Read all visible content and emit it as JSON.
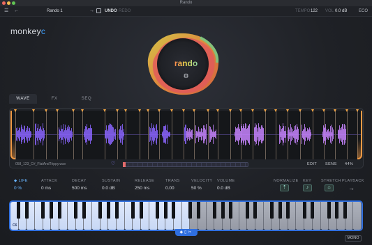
{
  "window": {
    "title": "Rando"
  },
  "toolbar": {
    "menu_icon": "hamburger-menu-icon",
    "back_icon": "arrow-left-icon",
    "preset_name": "Rando 1",
    "forward_icon": "arrow-right-icon",
    "save_icon": "save-icon",
    "undo_label": "UNDO",
    "redo_label": "REDO",
    "tempo_label": "TEMPO",
    "tempo_value": "122",
    "vol_label": "VOL",
    "vol_value": "0.0 dB",
    "eco_label": "ECO"
  },
  "brand": {
    "logo_text": "monkey",
    "logo_accent": "c",
    "accent_color": "#3ea0ff"
  },
  "blob": {
    "title": "rando",
    "gear_icon": "gear-icon"
  },
  "tabs": [
    {
      "label": "WAVE",
      "active": true
    },
    {
      "label": "FX",
      "active": false
    },
    {
      "label": "SEQ",
      "active": false
    }
  ],
  "waveform": {
    "filename": "058_123_C#_FlatAndTrippy.wav",
    "favorite_icon": "heart-icon",
    "edit_label": "EDIT",
    "sens_label": "SENS",
    "zoom": "44%",
    "colors": {
      "wave_start": "#8a64ff",
      "wave_end": "#c784ff",
      "trim": "#f29a45",
      "markers": "#f0a444"
    }
  },
  "params": [
    {
      "label": "LIFE",
      "value": "0 %",
      "highlight": true
    },
    {
      "label": "ATTACK",
      "value": "0 ms"
    },
    {
      "label": "DECAY",
      "value": "500 ms"
    },
    {
      "label": "SUSTAIN",
      "value": "0.0 dB"
    },
    {
      "label": "RELEASE",
      "value": "250 ms"
    },
    {
      "label": "TRANS",
      "value": "0.00"
    },
    {
      "label": "VELOCITY",
      "value": "50 %"
    },
    {
      "label": "VOLUME",
      "value": "0.0 dB"
    }
  ],
  "toggles": [
    {
      "label": "NORMALIZE",
      "icon": "normalize-icon"
    },
    {
      "label": "KEY",
      "icon": "music-note-icon"
    },
    {
      "label": "STRETCH",
      "icon": "stretch-icon"
    },
    {
      "label": "PLAYBACK",
      "icon": "arrow-right-icon"
    }
  ],
  "keyboard": {
    "start_note": "C6",
    "tab_label": "◆▯✂",
    "mono_label": "MONO",
    "highlight_color": "#2f6fe0"
  }
}
